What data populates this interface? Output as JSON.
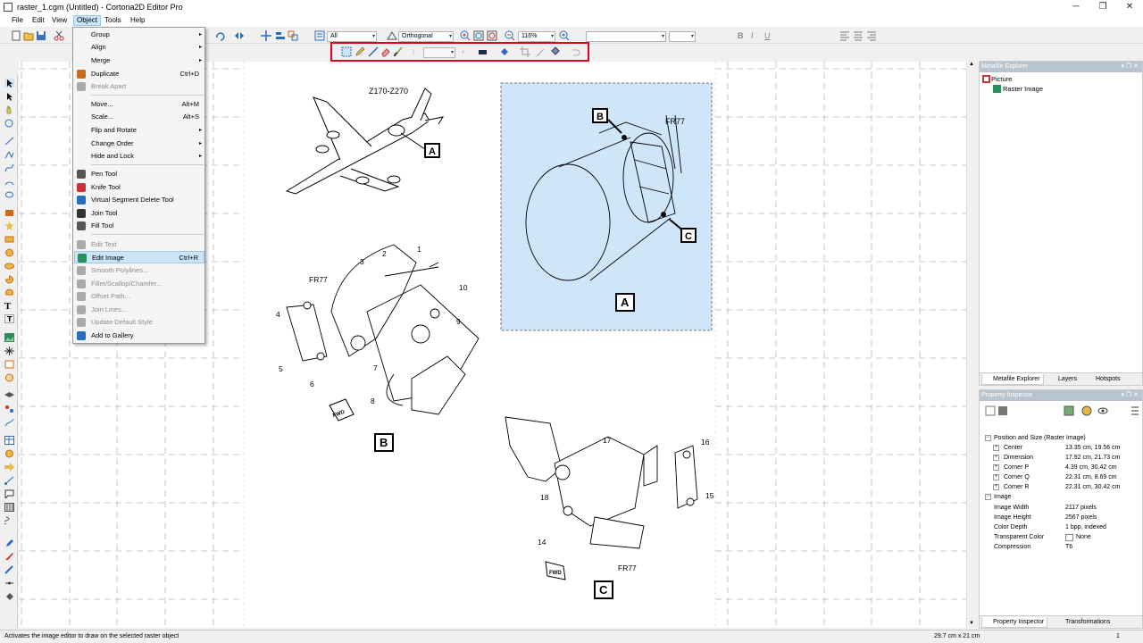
{
  "window": {
    "title": "raster_1.cgm (Untitled) - Cortona2D Editor Pro",
    "minimize": "─",
    "maximize": "❐",
    "close": "✕"
  },
  "menubar": [
    "File",
    "Edit",
    "View",
    "Object",
    "Tools",
    "Help"
  ],
  "toolbar": {
    "filter_value": "All",
    "projection_value": "Orthogonal",
    "zoom_value": "116%",
    "font_value": "",
    "size_value": "",
    "bold": "B",
    "italic": "I",
    "underline": "U"
  },
  "object_menu": [
    {
      "label": "Group",
      "shortcut": "",
      "submenu": true,
      "disabled": false,
      "icon": ""
    },
    {
      "label": "Align",
      "shortcut": "",
      "submenu": true,
      "disabled": false,
      "icon": ""
    },
    {
      "label": "Merge",
      "shortcut": "",
      "submenu": true,
      "disabled": false,
      "icon": ""
    },
    {
      "label": "Duplicate",
      "shortcut": "Ctrl+D",
      "submenu": false,
      "disabled": false,
      "icon": "duplicate-icon"
    },
    {
      "label": "Break Apart",
      "shortcut": "",
      "submenu": false,
      "disabled": true,
      "icon": "break-apart-icon"
    },
    {
      "label": "Move...",
      "shortcut": "Alt+M",
      "submenu": false,
      "disabled": false,
      "icon": ""
    },
    {
      "label": "Scale...",
      "shortcut": "Alt+S",
      "submenu": false,
      "disabled": false,
      "icon": ""
    },
    {
      "label": "Flip and Rotate",
      "shortcut": "",
      "submenu": true,
      "disabled": false,
      "icon": ""
    },
    {
      "label": "Change Order",
      "shortcut": "",
      "submenu": true,
      "disabled": false,
      "icon": ""
    },
    {
      "label": "Hide and Lock",
      "shortcut": "",
      "submenu": true,
      "disabled": false,
      "icon": ""
    },
    {
      "label": "Pen Tool",
      "shortcut": "",
      "submenu": false,
      "disabled": false,
      "icon": "pen-icon"
    },
    {
      "label": "Knife Tool",
      "shortcut": "",
      "submenu": false,
      "disabled": false,
      "icon": "knife-icon"
    },
    {
      "label": "Virtual Segment Delete Tool",
      "shortcut": "",
      "submenu": false,
      "disabled": false,
      "icon": "segment-delete-icon"
    },
    {
      "label": "Join Tool",
      "shortcut": "",
      "submenu": false,
      "disabled": false,
      "icon": "join-icon"
    },
    {
      "label": "Fill Tool",
      "shortcut": "",
      "submenu": false,
      "disabled": false,
      "icon": "fill-icon"
    },
    {
      "label": "Edit Text",
      "shortcut": "",
      "submenu": false,
      "disabled": true,
      "icon": "edit-text-icon"
    },
    {
      "label": "Edit Image",
      "shortcut": "Ctrl+R",
      "submenu": false,
      "disabled": false,
      "icon": "edit-image-icon",
      "highlighted": true
    },
    {
      "label": "Smooth Polylines...",
      "shortcut": "",
      "submenu": false,
      "disabled": true,
      "icon": "smooth-icon"
    },
    {
      "label": "Fillet/Scallop/Chamfer...",
      "shortcut": "",
      "submenu": false,
      "disabled": true,
      "icon": "fillet-icon"
    },
    {
      "label": "Offset Path...",
      "shortcut": "",
      "submenu": false,
      "disabled": true,
      "icon": "offset-icon"
    },
    {
      "label": "Join Lines...",
      "shortcut": "",
      "submenu": false,
      "disabled": true,
      "icon": "join-lines-icon"
    },
    {
      "label": "Update Default Style",
      "shortcut": "",
      "submenu": false,
      "disabled": true,
      "icon": "update-style-icon"
    },
    {
      "label": "Add to Gallery",
      "shortcut": "",
      "submenu": false,
      "disabled": false,
      "icon": "gallery-icon"
    }
  ],
  "drawing": {
    "zone_label": "Z170-Z270",
    "frame_label": "FR77",
    "callout_a": "A",
    "callout_b": "B",
    "callout_c": "C",
    "fwd": "FWD",
    "numbers_b": [
      "1",
      "2",
      "3",
      "4",
      "5",
      "6",
      "7",
      "8",
      "9",
      "10"
    ],
    "numbers_c": [
      "14",
      "15",
      "16",
      "17",
      "18"
    ]
  },
  "metafile_explorer": {
    "title": "Metafile Explorer",
    "root": "Picture",
    "child": "Raster Image",
    "tabs": [
      "Metafile Explorer",
      "Layers",
      "Hotspots"
    ]
  },
  "property_inspector": {
    "title": "Property Inspector",
    "section1": "Position and Size (Raster Image)",
    "rows1": [
      {
        "key": "Center",
        "value": "13.35 cm, 19.56 cm"
      },
      {
        "key": "Dimension",
        "value": "17.92 cm, 21.73 cm"
      },
      {
        "key": "Corner P",
        "value": "4.39 cm, 30.42 cm"
      },
      {
        "key": "Corner Q",
        "value": "22.31 cm, 8.69 cm"
      },
      {
        "key": "Corner R",
        "value": "22.31 cm, 30.42 cm"
      }
    ],
    "section2": "Image",
    "rows2": [
      {
        "key": "Image Width",
        "value": "2117 pixels"
      },
      {
        "key": "Image Height",
        "value": "2567 pixels"
      },
      {
        "key": "Color Depth",
        "value": "1 bpp, indexed"
      },
      {
        "key": "Transparent Color",
        "value": "None"
      },
      {
        "key": "Compression",
        "value": "T6"
      }
    ],
    "tabs": [
      "Property Inspector",
      "Transformations"
    ]
  },
  "statusbar": {
    "message": "Activates the image editor to draw on the selected raster object",
    "size": "29.7 cm x 21 cm",
    "page": "1"
  },
  "colors": {
    "selection_fill": "#cfe5fa",
    "highlight_border": "#e0001a",
    "menu_highlight": "#cce4f7"
  }
}
